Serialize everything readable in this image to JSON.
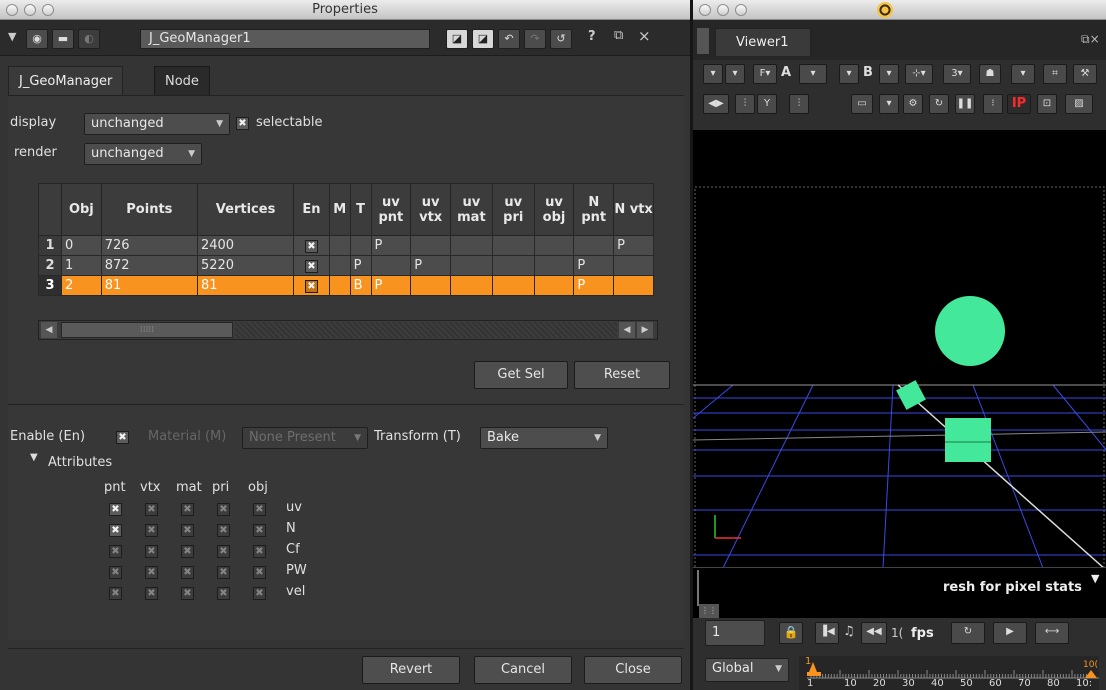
{
  "properties_window": {
    "title": "Properties",
    "node_name": "J_GeoManager1",
    "help_glyph": "?",
    "float_glyph": "⧉",
    "close_glyph": "×",
    "tabs": [
      {
        "label": "J_GeoManager"
      },
      {
        "label": "Node"
      }
    ],
    "display": {
      "label": "display",
      "value": "unchanged"
    },
    "selectable": {
      "label": "selectable",
      "checked": true
    },
    "render": {
      "label": "render",
      "value": "unchanged"
    },
    "table": {
      "columns": [
        "",
        "Obj",
        "Points",
        "Vertices",
        "En",
        "M",
        "T",
        "uv pnt",
        "uv vtx",
        "uv mat",
        "uv pri",
        "uv obj",
        "N pnt",
        "N vtx"
      ],
      "rows": [
        {
          "num": "1",
          "obj": "0",
          "points": "726",
          "vertices": "2400",
          "en": true,
          "m": "",
          "t": "",
          "uv_pnt": "P",
          "uv_vtx": "",
          "uv_mat": "",
          "uv_pri": "",
          "uv_obj": "",
          "n_pnt": "",
          "n_vtx": "P",
          "selected": false
        },
        {
          "num": "2",
          "obj": "1",
          "points": "872",
          "vertices": "5220",
          "en": true,
          "m": "",
          "t": "P",
          "uv_pnt": "",
          "uv_vtx": "P",
          "uv_mat": "",
          "uv_pri": "",
          "uv_obj": "",
          "n_pnt": "P",
          "n_vtx": "",
          "selected": false
        },
        {
          "num": "3",
          "obj": "2",
          "points": "81",
          "vertices": "81",
          "en": true,
          "m": "",
          "t": "B",
          "uv_pnt": "P",
          "uv_vtx": "",
          "uv_mat": "",
          "uv_pri": "",
          "uv_obj": "",
          "n_pnt": "P",
          "n_vtx": "",
          "selected": true
        }
      ]
    },
    "buttons": {
      "get_sel": "Get Sel",
      "reset": "Reset",
      "revert": "Revert",
      "cancel": "Cancel",
      "close": "Close"
    },
    "enable": {
      "label": "Enable (En)",
      "checked": true
    },
    "material": {
      "label": "Material (M)",
      "value": "None Present"
    },
    "transform": {
      "label": "Transform (T)",
      "value": "Bake"
    },
    "attributes": {
      "label": "Attributes",
      "columns": [
        "pnt",
        "vtx",
        "mat",
        "pri",
        "obj"
      ],
      "rows": [
        {
          "name": "uv",
          "active": [
            true,
            false,
            false,
            false,
            false
          ]
        },
        {
          "name": "N",
          "active": [
            true,
            false,
            false,
            false,
            false
          ]
        },
        {
          "name": "Cf",
          "active": [
            false,
            false,
            false,
            false,
            false
          ]
        },
        {
          "name": "PW",
          "active": [
            false,
            false,
            false,
            false,
            false
          ]
        },
        {
          "name": "vel",
          "active": [
            false,
            false,
            false,
            false,
            false
          ]
        }
      ]
    }
  },
  "viewer": {
    "tab": "Viewer1",
    "channel_a": "A",
    "channel_b": "B",
    "channel_y": "Y",
    "ip_label": "IP",
    "status_text": "resh for pixel stats",
    "frame": "1",
    "fps_partial": "1(",
    "fps_label": "fps",
    "global": "Global",
    "timeline_ticks": [
      "1",
      "10",
      "20",
      "30",
      "40",
      "50",
      "60",
      "70",
      "80",
      "10:"
    ],
    "timeline_end": "10("
  },
  "colors": {
    "selection": "#f7931e",
    "sphere": "#43e89a",
    "grid": "#3a4ae6"
  }
}
